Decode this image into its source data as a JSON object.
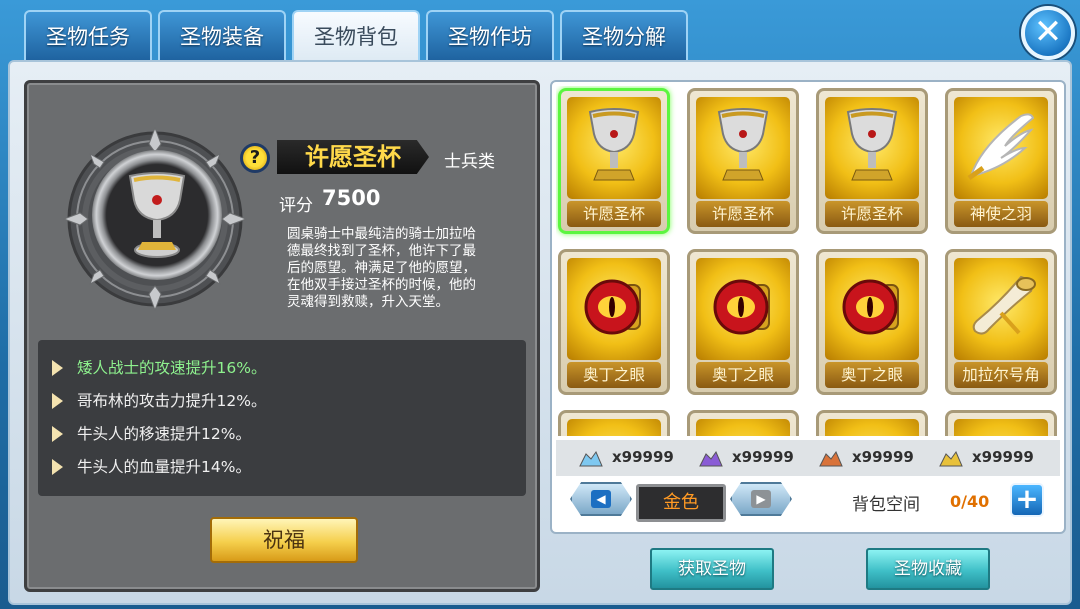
{
  "tabs": [
    "圣物任务",
    "圣物装备",
    "圣物背包",
    "圣物作坊",
    "圣物分解"
  ],
  "active_tab": 2,
  "detail": {
    "name": "许愿圣杯",
    "class": "士兵类",
    "score_label": "评分",
    "score": "7500",
    "description": [
      "圆桌骑士中最纯洁的骑士加拉哈",
      "德最终找到了圣杯，他许下了最",
      "后的愿望。神满足了他的愿望，",
      "在他双手接过圣杯的时候，他的",
      "灵魂得到救赎，升入天堂。"
    ],
    "effects": [
      "矮人战士的攻速提升16%。",
      "哥布林的攻击力提升12%。",
      "牛头人的移速提升12%。",
      "牛头人的血量提升14%。"
    ],
    "bless_label": "祝福"
  },
  "inventory": [
    {
      "label": "许愿圣杯",
      "icon": "grail-icon"
    },
    {
      "label": "许愿圣杯",
      "icon": "grail-icon"
    },
    {
      "label": "许愿圣杯",
      "icon": "grail-icon"
    },
    {
      "label": "神使之羽",
      "icon": "wing-icon"
    },
    {
      "label": "奥丁之眼",
      "icon": "eye-icon"
    },
    {
      "label": "奥丁之眼",
      "icon": "eye-icon"
    },
    {
      "label": "奥丁之眼",
      "icon": "eye-icon"
    },
    {
      "label": "加拉尔号角",
      "icon": "horn-icon"
    }
  ],
  "resources": [
    {
      "icon": "blue-gem-icon",
      "value": "x99999",
      "color": "#7ec8f0"
    },
    {
      "icon": "purple-gem-icon",
      "value": "x99999",
      "color": "#8a5cd6"
    },
    {
      "icon": "orange-gem-icon",
      "value": "x99999",
      "color": "#d9733a"
    },
    {
      "icon": "gold-gem-icon",
      "value": "x99999",
      "color": "#e8c13a"
    }
  ],
  "filter": {
    "quality": "金色"
  },
  "bag": {
    "label": "背包空间",
    "count": "0/40"
  },
  "buttons": {
    "get_relic": "获取圣物",
    "relic_collection": "圣物收藏"
  }
}
